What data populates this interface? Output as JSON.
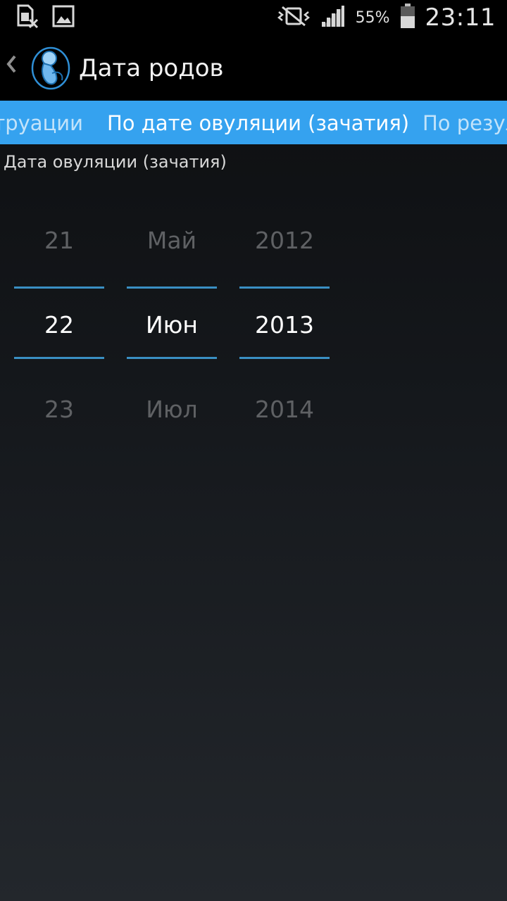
{
  "status_bar": {
    "left_icons": [
      "sim-card-icon",
      "gallery-icon"
    ],
    "right_icons": [
      "mute-vibrate-icon",
      "signal-icon",
      "battery-icon"
    ],
    "battery_percent": "55%",
    "time": "23:11"
  },
  "action_bar": {
    "back_icon": "back-caret-icon",
    "app_icon": "fetus-logo-icon",
    "title": "Дата родов"
  },
  "tabs": {
    "previous": "труации",
    "current": "По дате овуляции (зачатия)",
    "next": "По резул"
  },
  "picker": {
    "label": "Дата овуляции (зачатия)",
    "day": {
      "prev": "21",
      "selected": "22",
      "next": "23"
    },
    "month": {
      "prev": "Май",
      "selected": "Июн",
      "next": "Июл"
    },
    "year": {
      "prev": "2012",
      "selected": "2013",
      "next": "2014"
    }
  },
  "colors": {
    "tab_background": "#35a2ef",
    "divider": "#3a8fc3",
    "unselected_text": "#5f6164"
  }
}
